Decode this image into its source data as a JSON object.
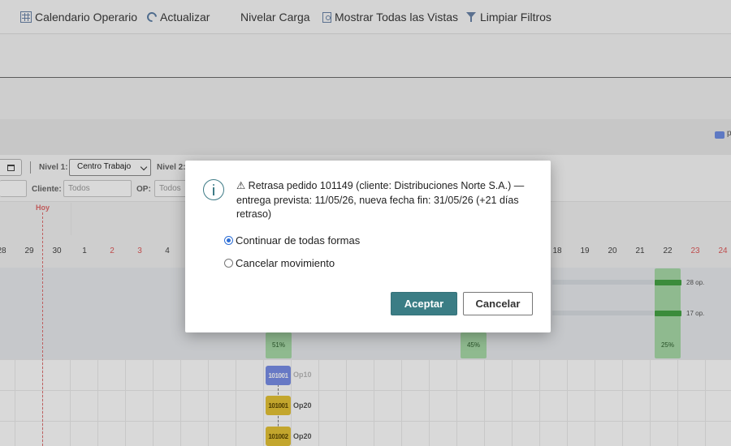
{
  "toolbar": {
    "calendar_label": "Calendario Operario",
    "refresh_label": "Actualizar",
    "level_label": "Nivelar Carga",
    "show_views_label": "Mostrar Todas las Vistas",
    "clear_filters_label": "Limpiar Filtros"
  },
  "legend": {
    "text": "p",
    "color": "#6f8fe6"
  },
  "filters": {
    "level1_label": "Nivel 1:",
    "level1_value": "Centro Trabajo",
    "level2_label": "Nivel 2:",
    "client_label": "Cliente:",
    "client_placeholder": "Todos",
    "op_label": "OP:",
    "op_placeholder": "Todos"
  },
  "timeline": {
    "today_label": "Hoy",
    "days": [
      "28",
      "29",
      "30",
      "1",
      "2",
      "3",
      "4",
      "18",
      "19",
      "20",
      "21",
      "22",
      "23",
      "24"
    ],
    "weekend_days": [
      "2",
      "3",
      "23",
      "24"
    ]
  },
  "load": {
    "columns": [
      {
        "pct": "51%"
      },
      {
        "pct": "45%"
      },
      {
        "pct": "25%"
      }
    ],
    "bar1_label": "28 op.",
    "bar2_label": "17 op."
  },
  "tasks": [
    {
      "code": "101001",
      "op": "Op10"
    },
    {
      "code": "101001",
      "op": "Op20"
    },
    {
      "code": "101002",
      "op": "Op20"
    }
  ],
  "dialog": {
    "message": "⚠ Retrasa pedido 101149 (cliente: Distribuciones Norte S.A.) — entrega prevista: 11/05/26, nueva fecha fin: 31/05/26 (+21 días retraso)",
    "option_continue": "Continuar de todas formas",
    "option_cancel": "Cancelar movimiento",
    "selected_option": "continue",
    "accept_label": "Aceptar",
    "cancel_label": "Cancelar"
  },
  "colors": {
    "accent": "#3b7d85",
    "load_ok": "#46a546",
    "task_blue": "#7a8fe8",
    "task_yellow": "#e6c335",
    "today": "#e07070"
  }
}
